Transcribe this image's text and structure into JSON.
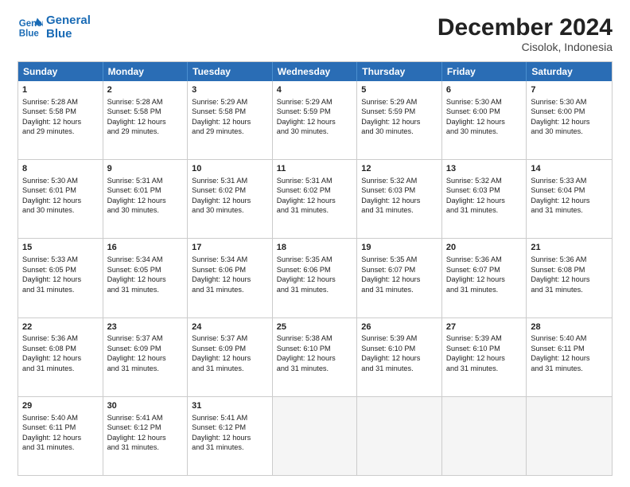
{
  "logo": {
    "line1": "General",
    "line2": "Blue"
  },
  "title": "December 2024",
  "subtitle": "Cisolok, Indonesia",
  "days": [
    "Sunday",
    "Monday",
    "Tuesday",
    "Wednesday",
    "Thursday",
    "Friday",
    "Saturday"
  ],
  "rows": [
    [
      {
        "num": "1",
        "lines": [
          "Sunrise: 5:28 AM",
          "Sunset: 5:58 PM",
          "Daylight: 12 hours",
          "and 29 minutes."
        ]
      },
      {
        "num": "2",
        "lines": [
          "Sunrise: 5:28 AM",
          "Sunset: 5:58 PM",
          "Daylight: 12 hours",
          "and 29 minutes."
        ]
      },
      {
        "num": "3",
        "lines": [
          "Sunrise: 5:29 AM",
          "Sunset: 5:58 PM",
          "Daylight: 12 hours",
          "and 29 minutes."
        ]
      },
      {
        "num": "4",
        "lines": [
          "Sunrise: 5:29 AM",
          "Sunset: 5:59 PM",
          "Daylight: 12 hours",
          "and 30 minutes."
        ]
      },
      {
        "num": "5",
        "lines": [
          "Sunrise: 5:29 AM",
          "Sunset: 5:59 PM",
          "Daylight: 12 hours",
          "and 30 minutes."
        ]
      },
      {
        "num": "6",
        "lines": [
          "Sunrise: 5:30 AM",
          "Sunset: 6:00 PM",
          "Daylight: 12 hours",
          "and 30 minutes."
        ]
      },
      {
        "num": "7",
        "lines": [
          "Sunrise: 5:30 AM",
          "Sunset: 6:00 PM",
          "Daylight: 12 hours",
          "and 30 minutes."
        ]
      }
    ],
    [
      {
        "num": "8",
        "lines": [
          "Sunrise: 5:30 AM",
          "Sunset: 6:01 PM",
          "Daylight: 12 hours",
          "and 30 minutes."
        ]
      },
      {
        "num": "9",
        "lines": [
          "Sunrise: 5:31 AM",
          "Sunset: 6:01 PM",
          "Daylight: 12 hours",
          "and 30 minutes."
        ]
      },
      {
        "num": "10",
        "lines": [
          "Sunrise: 5:31 AM",
          "Sunset: 6:02 PM",
          "Daylight: 12 hours",
          "and 30 minutes."
        ]
      },
      {
        "num": "11",
        "lines": [
          "Sunrise: 5:31 AM",
          "Sunset: 6:02 PM",
          "Daylight: 12 hours",
          "and 31 minutes."
        ]
      },
      {
        "num": "12",
        "lines": [
          "Sunrise: 5:32 AM",
          "Sunset: 6:03 PM",
          "Daylight: 12 hours",
          "and 31 minutes."
        ]
      },
      {
        "num": "13",
        "lines": [
          "Sunrise: 5:32 AM",
          "Sunset: 6:03 PM",
          "Daylight: 12 hours",
          "and 31 minutes."
        ]
      },
      {
        "num": "14",
        "lines": [
          "Sunrise: 5:33 AM",
          "Sunset: 6:04 PM",
          "Daylight: 12 hours",
          "and 31 minutes."
        ]
      }
    ],
    [
      {
        "num": "15",
        "lines": [
          "Sunrise: 5:33 AM",
          "Sunset: 6:05 PM",
          "Daylight: 12 hours",
          "and 31 minutes."
        ]
      },
      {
        "num": "16",
        "lines": [
          "Sunrise: 5:34 AM",
          "Sunset: 6:05 PM",
          "Daylight: 12 hours",
          "and 31 minutes."
        ]
      },
      {
        "num": "17",
        "lines": [
          "Sunrise: 5:34 AM",
          "Sunset: 6:06 PM",
          "Daylight: 12 hours",
          "and 31 minutes."
        ]
      },
      {
        "num": "18",
        "lines": [
          "Sunrise: 5:35 AM",
          "Sunset: 6:06 PM",
          "Daylight: 12 hours",
          "and 31 minutes."
        ]
      },
      {
        "num": "19",
        "lines": [
          "Sunrise: 5:35 AM",
          "Sunset: 6:07 PM",
          "Daylight: 12 hours",
          "and 31 minutes."
        ]
      },
      {
        "num": "20",
        "lines": [
          "Sunrise: 5:36 AM",
          "Sunset: 6:07 PM",
          "Daylight: 12 hours",
          "and 31 minutes."
        ]
      },
      {
        "num": "21",
        "lines": [
          "Sunrise: 5:36 AM",
          "Sunset: 6:08 PM",
          "Daylight: 12 hours",
          "and 31 minutes."
        ]
      }
    ],
    [
      {
        "num": "22",
        "lines": [
          "Sunrise: 5:36 AM",
          "Sunset: 6:08 PM",
          "Daylight: 12 hours",
          "and 31 minutes."
        ]
      },
      {
        "num": "23",
        "lines": [
          "Sunrise: 5:37 AM",
          "Sunset: 6:09 PM",
          "Daylight: 12 hours",
          "and 31 minutes."
        ]
      },
      {
        "num": "24",
        "lines": [
          "Sunrise: 5:37 AM",
          "Sunset: 6:09 PM",
          "Daylight: 12 hours",
          "and 31 minutes."
        ]
      },
      {
        "num": "25",
        "lines": [
          "Sunrise: 5:38 AM",
          "Sunset: 6:10 PM",
          "Daylight: 12 hours",
          "and 31 minutes."
        ]
      },
      {
        "num": "26",
        "lines": [
          "Sunrise: 5:39 AM",
          "Sunset: 6:10 PM",
          "Daylight: 12 hours",
          "and 31 minutes."
        ]
      },
      {
        "num": "27",
        "lines": [
          "Sunrise: 5:39 AM",
          "Sunset: 6:10 PM",
          "Daylight: 12 hours",
          "and 31 minutes."
        ]
      },
      {
        "num": "28",
        "lines": [
          "Sunrise: 5:40 AM",
          "Sunset: 6:11 PM",
          "Daylight: 12 hours",
          "and 31 minutes."
        ]
      }
    ],
    [
      {
        "num": "29",
        "lines": [
          "Sunrise: 5:40 AM",
          "Sunset: 6:11 PM",
          "Daylight: 12 hours",
          "and 31 minutes."
        ]
      },
      {
        "num": "30",
        "lines": [
          "Sunrise: 5:41 AM",
          "Sunset: 6:12 PM",
          "Daylight: 12 hours",
          "and 31 minutes."
        ]
      },
      {
        "num": "31",
        "lines": [
          "Sunrise: 5:41 AM",
          "Sunset: 6:12 PM",
          "Daylight: 12 hours",
          "and 31 minutes."
        ]
      },
      null,
      null,
      null,
      null
    ]
  ]
}
